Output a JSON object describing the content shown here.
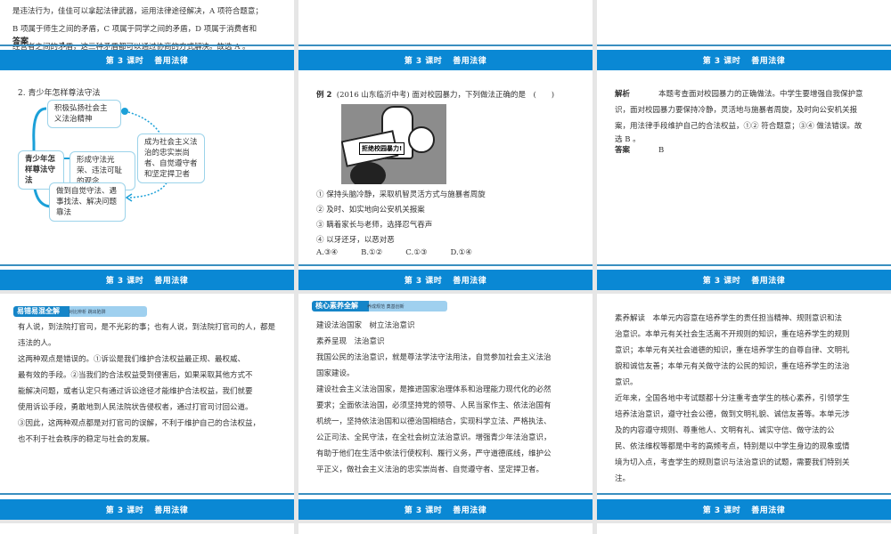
{
  "header_title": {
    "lesson": "第 3 课时",
    "topic": "善用法律"
  },
  "s1": {
    "lines": [
      "是违法行为，佳佳可以拿起法律武器，运用法律途径解决，A 项符合题意；",
      "B 项属于师生之间的矛盾，C 项属于同学之间的矛盾，D 项属于消费者和",
      "经营者之间的矛盾，这三种矛盾都可以通过协商的方式解决。故选 A 。"
    ],
    "answer_label": "答案",
    "answer": "A"
  },
  "s4": {
    "title": "2. 青少年怎样尊法守法",
    "center": "青少年怎样尊法守法",
    "n1": "积极弘扬社会主义法治精神",
    "n2": "形成守法光荣、违法可耻的观念",
    "n3": "做到自觉守法、遇事找法、解决问题靠法",
    "n4": "成为社会主义法治的忠实崇尚者、自觉遵守者和坚定捍卫者"
  },
  "s5": {
    "label": "例 2",
    "question": "(2016 山东临沂中考) 面对校园暴力，下列做法正确的是　(　　)",
    "image_text": "拒绝校园暴力!",
    "options": [
      "① 保持头脑冷静，采取机智灵活方式与施暴者周旋",
      "② 及时、如实地向公安机关报案",
      "③ 瞒着家长与老师，选择忍气吞声",
      "④ 以牙还牙，以恶对恶"
    ],
    "choices": [
      "A.③④",
      "B.①②",
      "C.①③",
      "D.①④"
    ]
  },
  "s6": {
    "analysis_label": "解析",
    "analysis": [
      "本题考查面对校园暴力的正确做法。中学生要增强自我保护意",
      "识，面对校园暴力要保持冷静，灵活地与施暴者周旋，及时向公安机关报",
      "案，用法律手段维护自己的合法权益，①② 符合题意；③④ 做法错误。故",
      "选 B 。"
    ],
    "answer_label": "答案",
    "answer": "B"
  },
  "s7": {
    "tag": "易错易混全解",
    "tag_sub": "对比辨析 跳出陷阱",
    "lines": [
      "有人说，到法院打官司，是不光彩的事；也有人说，到法院打官司的人，都是",
      "违法的人。",
      "这两种观点是错误的。①诉讼是我们维护合法权益最正规、最权威、",
      "最有效的手段。②当我们的合法权益受到侵害后，如果采取其他方式不",
      "能解决问题，或者认定只有通过诉讼途径才能维护合法权益，我们就要",
      "使用诉讼手段，勇敢地到人民法院状告侵权者，通过打官司讨回公道。",
      "③因此，这两种观点都是对打官司的误解，不利于维护自己的合法权益，",
      "也不利于社会秩序的稳定与社会的发展。"
    ]
  },
  "s8": {
    "tag": "核心素养全解",
    "tag_sub": "养成规范 奠基创新",
    "lines": [
      "建设法治国家　树立法治意识",
      "素养呈现　法治意识",
      "我国公民的法治意识，就是尊法学法守法用法，自觉参加社会主义法治",
      "国家建设。",
      "建设社会主义法治国家，是推进国家治理体系和治理能力现代化的必然",
      "要求；全面依法治国，必须坚持党的领导、人民当家作主、依法治国有",
      "机统一，坚持依法治国和以德治国相结合，实现科学立法、严格执法、",
      "公正司法、全民守法，在全社会树立法治意识。增强青少年法治意识，",
      "有助于他们在生活中依法行使权利、履行义务，严守道德底线，维护公",
      "平正义，做社会主义法治的忠实崇尚者、自觉遵守者、坚定捍卫者。"
    ]
  },
  "s9": {
    "lines": [
      "素养解读　本单元内容意在培养学生的责任担当精神、规则意识和法",
      "治意识。本单元有关社会生活离不开规则的知识，重在培养学生的规则",
      "意识；本单元有关社会道德的知识，重在培养学生的自尊自律、文明礼",
      "貌和诚信友善；本单元有关做守法的公民的知识，重在培养学生的法治",
      "意识。",
      "近年来，全国各地中考试题都十分注重考查学生的核心素养，引领学生",
      "培养法治意识，遵守社会公德，做到文明礼貌、诚信友善等。本单元涉",
      "及的内容遵守规则、尊重他人、文明有礼、诚实守信、做守法的公",
      "民、依法维权等都是中考的高频考点，特别是以中学生身边的现象或情",
      "境为切入点，考查学生的规则意识与法治意识的试题，需要我们特别关",
      "注。"
    ]
  }
}
